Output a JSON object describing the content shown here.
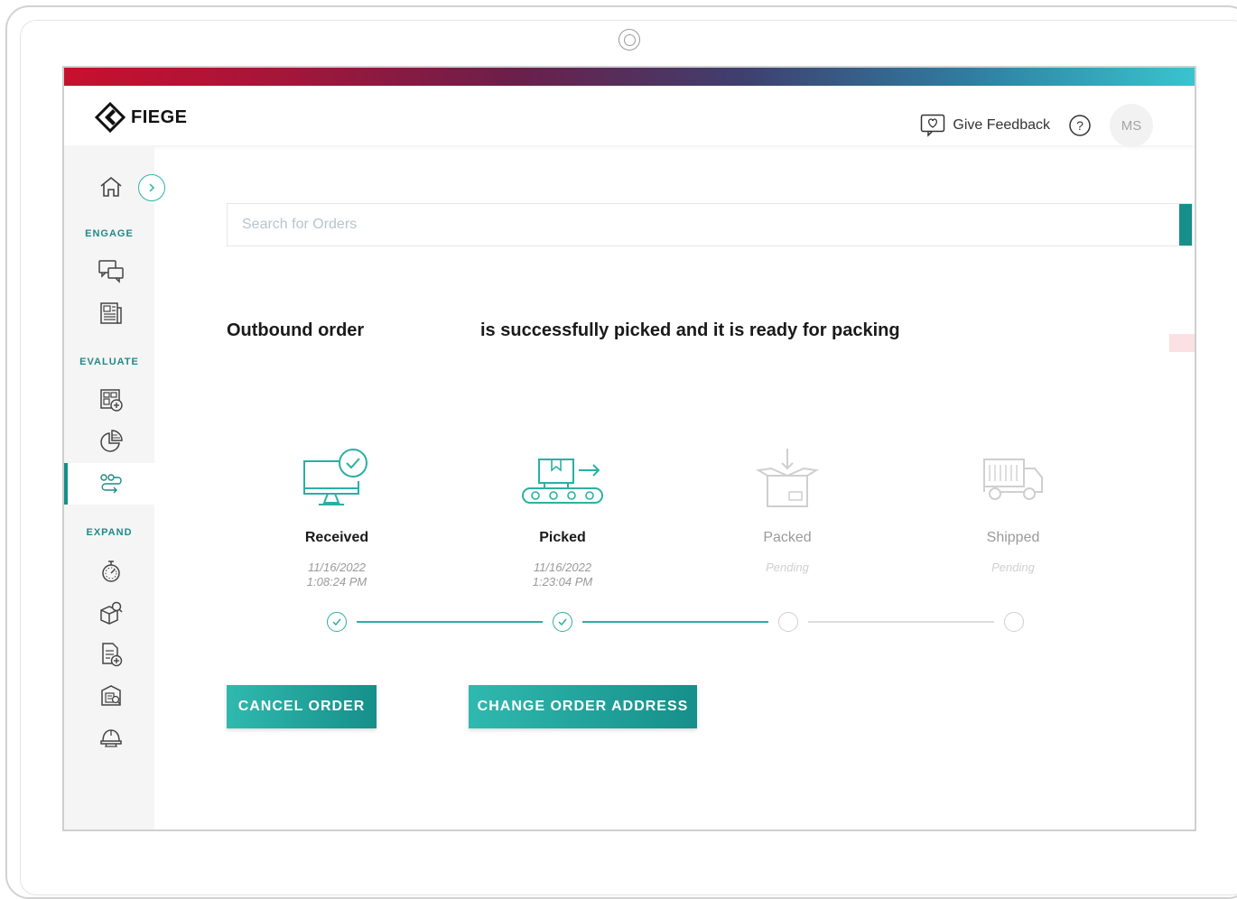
{
  "app": {
    "logo_text": "FIEGE",
    "brand_color": "#168f8a"
  },
  "header": {
    "feedback_label": "Give Feedback",
    "avatar_initials": "MS"
  },
  "sidebar": {
    "sections": [
      "ENGAGE",
      "EVALUATE",
      "EXPAND"
    ],
    "items": [
      {
        "icon": "home-icon",
        "section": "",
        "active": false
      },
      {
        "icon": "chat-bubbles-icon",
        "section": "ENGAGE",
        "active": false
      },
      {
        "icon": "newspaper-icon",
        "section": "ENGAGE",
        "active": false
      },
      {
        "icon": "dashboard-add-icon",
        "section": "EVALUATE",
        "active": false
      },
      {
        "icon": "pie-chart-icon",
        "section": "EVALUATE",
        "active": false
      },
      {
        "icon": "flow-icon",
        "section": "EVALUATE",
        "active": true
      },
      {
        "icon": "stopwatch-icon",
        "section": "EXPAND",
        "active": false
      },
      {
        "icon": "package-search-icon",
        "section": "EXPAND",
        "active": false
      },
      {
        "icon": "document-add-icon",
        "section": "EXPAND",
        "active": false
      },
      {
        "icon": "catalog-icon",
        "section": "EXPAND",
        "active": false
      },
      {
        "icon": "hard-hat-icon",
        "section": "EXPAND",
        "active": false
      }
    ]
  },
  "search": {
    "placeholder": "Search for Orders"
  },
  "order": {
    "message_prefix": "Outbound order",
    "message_suffix": "is successfully picked and it is ready for packing"
  },
  "steps": [
    {
      "label": "Received",
      "date": "11/16/2022",
      "time": "1:08:24 PM",
      "status": "done",
      "icon": "monitor-check-icon"
    },
    {
      "label": "Picked",
      "date": "11/16/2022",
      "time": "1:23:04 PM",
      "status": "done",
      "icon": "conveyor-icon"
    },
    {
      "label": "Packed",
      "date": "Pending",
      "time": "",
      "status": "pending",
      "icon": "open-box-icon"
    },
    {
      "label": "Shipped",
      "date": "Pending",
      "time": "",
      "status": "pending",
      "icon": "truck-icon"
    }
  ],
  "actions": {
    "cancel_label": "CANCEL ORDER",
    "change_address_label": "CHANGE ORDER ADDRESS"
  },
  "colors": {
    "accent": "#168f8a",
    "done": "#2ab0a3",
    "pending": "#cfcfcf"
  }
}
